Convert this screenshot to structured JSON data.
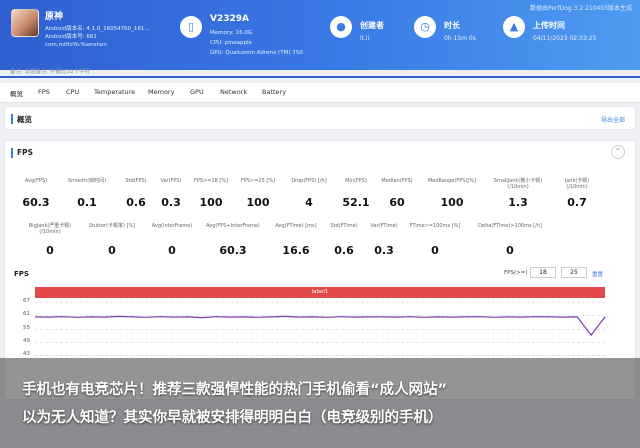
{
  "header": {
    "history_link": "数据由PerfDog 3.2.210403版本生成",
    "app": {
      "name": "原神",
      "version_line1": "Android版本名: 4.1.0_16054760_161...",
      "version_line2": "Android版本号: 661",
      "package": "com.miHoYo.Yuanshen"
    },
    "note": "备注: 设置备注, 不超过32个字符",
    "device": {
      "model": "V2329A",
      "memory": "Memory: 16.0G",
      "cpu": "CPU: pineapple",
      "gpu": "GPU: Qualcomm Adreno (TM) 750"
    },
    "creator": {
      "label": "创建者",
      "value": "lt.li"
    },
    "duration": {
      "label": "时长",
      "value": "0h 15m 0s"
    },
    "upload": {
      "label": "上传时间",
      "value": "04/11/2023 02:33:25"
    }
  },
  "tabs": [
    "概览",
    "FPS",
    "CPU",
    "Temperature",
    "Memory",
    "GPU",
    "Network",
    "Battery"
  ],
  "overview": {
    "title": "概览",
    "action": "导出全部"
  },
  "fps": {
    "title": "FPS",
    "row1": [
      {
        "label": "Avg(FPS)",
        "value": "60.3"
      },
      {
        "label": "Smooth(帧时间)",
        "value": "0.1"
      },
      {
        "label": "Std(FPS)",
        "value": "0.6"
      },
      {
        "label": "Var(FPS)",
        "value": "0.3"
      },
      {
        "label": "FPS>=18 [%]",
        "value": "100"
      },
      {
        "label": "FPS>=25 [%]",
        "value": "100"
      },
      {
        "label": "Drop(FPS) [/h]",
        "value": "4"
      },
      {
        "label": "Min(FPS)",
        "value": "52.1"
      },
      {
        "label": "Median(FPS)",
        "value": "60"
      },
      {
        "label": "MedRange(FPS)[%]",
        "value": "100"
      },
      {
        "label": "SmallJank(微小卡顿)\n(/10min)",
        "value": "1.3"
      },
      {
        "label": "Jank(卡顿)\n(/10min)",
        "value": "0.7"
      }
    ],
    "row2": [
      {
        "label": "BigJank(严重卡顿)\n(/10min)",
        "value": "0"
      },
      {
        "label": "Stutter(卡顿率) [%]",
        "value": "0"
      },
      {
        "label": "Avg(InterFrame)",
        "value": "0"
      },
      {
        "label": "Avg(FPS+InterFrame)",
        "value": "60.3"
      },
      {
        "label": "Avg(FTime) [ms]",
        "value": "16.6"
      },
      {
        "label": "Std(FTime)",
        "value": "0.6"
      },
      {
        "label": "Var(FTime)",
        "value": "0.3"
      },
      {
        "label": "FTime>=100ms [%]",
        "value": "0"
      },
      {
        "label": "Delta(FTime)>100ms [/h]",
        "value": "0"
      }
    ]
  },
  "chart_section": {
    "title": "FPS",
    "fps_filter_label": "FPS(>=)",
    "fps_filter_values": [
      "18",
      "25"
    ],
    "reset_label": "重置",
    "label_bar": "label1",
    "label_bar_color": "#e24a4a",
    "series_color": "#7a3fa8"
  },
  "chart_data": {
    "type": "line",
    "title": "FPS",
    "yticks": [
      "67",
      "61",
      "55",
      "49",
      "43"
    ],
    "ylim": [
      40,
      67
    ],
    "series": [
      {
        "values": [
          60.3,
          60.2,
          60.4,
          60.1,
          60.3,
          60.2,
          60.5,
          60.3,
          60.1,
          60.4,
          60.2,
          60.3,
          60.0,
          60.4,
          60.2,
          60.3,
          60.1,
          60.3,
          60.5,
          60.2,
          60.3,
          60.1,
          60.4,
          60.2,
          60.3,
          60.3,
          60.2,
          60.4,
          60.1,
          60.3,
          60.2,
          60.3,
          60.4,
          60.1,
          60.3,
          60.2,
          60.4,
          60.3,
          60.2,
          60.3,
          52.1,
          60.3
        ]
      }
    ]
  },
  "caption": {
    "line1": "手机也有电竞芯片！推荐三款强悍性能的热门手机偷看“成人网站”",
    "line2": "以为无人知道？其实你早就被安排得明明白白（电竞级别的手机）"
  }
}
